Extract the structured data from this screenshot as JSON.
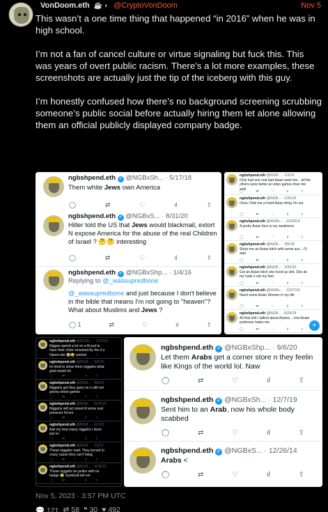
{
  "author": {
    "display_name": "VonDoom.eth",
    "icons": "☕ ◐",
    "handle": "@CryptoVonDoom",
    "date": "Nov 5"
  },
  "post": {
    "paragraphs": [
      "This wasn’t a one time thing that happened “in 2016” when he was in high school.",
      "I’m not a fan of cancel culture or virtue signaling but fuck this. This was years of overt public racism. There’s a lot more examples, these screenshots are actually just the tip of the iceberg with this guy.",
      "I’m honestly confused how there’s no background screening scrubbing someone’s public social before actually hiring them let alone allowing them an official publicly displayed company badge."
    ]
  },
  "screenshot1": {
    "tweets": [
      {
        "name": "ngbshpend.eth",
        "meta": "@NGBxSh... · 5/17/18",
        "text_pre": "Them white ",
        "text_bold": "Jews",
        "text_post": " own America",
        "actions": [
          "",
          "",
          "",
          "",
          ""
        ]
      },
      {
        "name": "ngbshpend.eth",
        "meta": "@NGBxS... · 8/31/20",
        "text_pre": "Hitler told the US that ",
        "text_bold": "Jews",
        "text_post": " would blackmail, extort N expose America for the abuse of the real Children of Israel ? 🤔🤔 interesting",
        "actions": [
          "",
          "",
          "",
          "",
          ""
        ]
      },
      {
        "name": "ngbshpend.eth",
        "meta": "@NGBxShp... · 1/4/16",
        "reply_pre": "Replying to ",
        "reply_link": "@_wassupredbone",
        "text_link": "@_wassupredbone",
        "text_pre": " and just because I don't believe in the bible that means I'm not going to \"heaven\"? What about Muslims and ",
        "text_bold": "Jews",
        "text_post": " ?",
        "actions": [
          "1",
          "",
          "",
          "",
          ""
        ]
      }
    ]
  },
  "screenshot2": {
    "tweets": [
      {
        "name": "ngbshpend.eth",
        "meta": "@NGB... · 1/3/19",
        "text": "Only had one real bad Asian want me... all the others were better at video games than me smh"
      },
      {
        "name": "ngbshpend.eth",
        "meta": "@NGB... · 1/26/19",
        "text": "Once I find me a hood Asian thing I'm out"
      },
      {
        "name": "ngbshpend.eth",
        "meta": "@NGBx... · 12/29/14",
        "text": "A pretty Asian face is my weakness"
      },
      {
        "name": "ngbshpend.eth",
        "meta": "@NGB... · 3/5/18",
        "text": "Show me an Asian bitch with some ass... I'll wait"
      },
      {
        "name": "ngbshpend.eth",
        "meta": "@NGB... · 2/30/20",
        "text": "Got an Asian bitch she hood as shit. She do my nails n rub my feet"
      },
      {
        "name": "ngbshpend.eth",
        "meta": "@NGBx... · 12/27/16",
        "text": "Need some Asian Women in my life"
      },
      {
        "name": "ngbshpend.eth",
        "meta": "@NGB... · 6/29/19",
        "text": "All that shit I talked about Asians... now Asian professor hates me"
      }
    ],
    "fab": "+"
  },
  "screenshot3": {
    "tweets": [
      {
        "name": "ngbshpend.eth",
        "meta": "@NGBx... · 1/25/19",
        "text": "Niggas spend a lot on a fit just to have their chick smacked by the it a Hanes tee 😂😂 wicked"
      },
      {
        "name": "ngbshpend.eth",
        "meta": "@NGB... · 9/6/20",
        "text": "Im tired to show them niggahs what goat would do"
      },
      {
        "name": "ngbshpend.eth",
        "meta": "@NGB... · 8/6/20",
        "text": "Niggahs got they guns on n still not gonna shoot games"
      },
      {
        "name": "ngbshpend.eth",
        "meta": "@NGB... · 5/23/18",
        "text": "Niggahs will act street til some real pressure hit em"
      },
      {
        "name": "ngbshpend.eth",
        "meta": "@NGB... · 2/7/20",
        "text": "Ask my how many niggahs I done put on"
      },
      {
        "name": "ngbshpend.eth",
        "meta": "@NGB... · 12/19",
        "text": "These niggahs mad. They turned to crazy cause they can't hang"
      },
      {
        "name": "ngbshpend.eth",
        "meta": "@NGB... · 4/18/19",
        "text": "These niggahs be police with no badge 😂 Sumbodi tell em"
      }
    ]
  },
  "screenshot4": {
    "tweets": [
      {
        "name": "ngbshpend.eth",
        "meta": "@NGBxShp... · 9/6/20",
        "text_pre": "Let them ",
        "text_bold": "Arabs",
        "text_post": " get a corner store n they feelin like Kings of the world lol. Naw"
      },
      {
        "name": "ngbshpend.eth",
        "meta": "@NGBxSh... · 12/7/19",
        "text_pre": "Sent him to an ",
        "text_bold": "Arab",
        "text_post": ", now his whole body scabbed"
      },
      {
        "name": "ngbshpend.eth",
        "meta": "@NGBxS... · 12/26/14",
        "text_pre": "",
        "text_bold": "Arabs",
        "text_post": " <"
      }
    ]
  },
  "footer": {
    "timestamp": "Nov 5, 2023 · 3:57 PM UTC",
    "replies": "💬 121",
    "retweets": "⇄ 58",
    "quotes": "❝ 30",
    "likes": "♥ 492"
  },
  "colors": {
    "accent": "#f7543f",
    "twitter_blue": "#1d9bf0"
  }
}
